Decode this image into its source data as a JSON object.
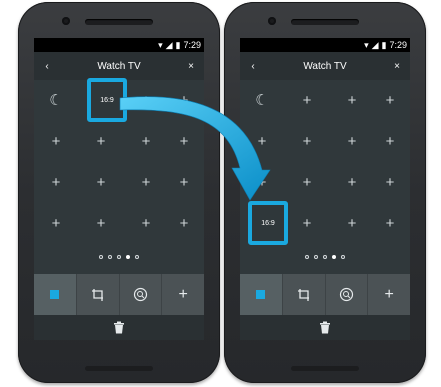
{
  "status_bar": {
    "time": "7:29"
  },
  "header": {
    "title": "Watch TV",
    "back_icon": "chevron-left-icon",
    "close_icon": "close-icon"
  },
  "grid": {
    "moon_icon": "moon-icon",
    "add_icon": "plus-icon",
    "aspect_ratio_label": "16:9",
    "page_dots": 5,
    "active_page": 4
  },
  "toolbar": {
    "items": [
      {
        "icon": "square-icon"
      },
      {
        "icon": "crop-icon"
      },
      {
        "icon": "zoom-icon"
      },
      {
        "icon": "plus-icon"
      }
    ]
  },
  "footer": {
    "icon": "trash-icon"
  },
  "colors": {
    "accent": "#1aa9e0",
    "screen_bg": "#30383b",
    "toolbar_bg": "#4b5255"
  },
  "annotation": {
    "arrow_icon": "curved-arrow-icon"
  }
}
